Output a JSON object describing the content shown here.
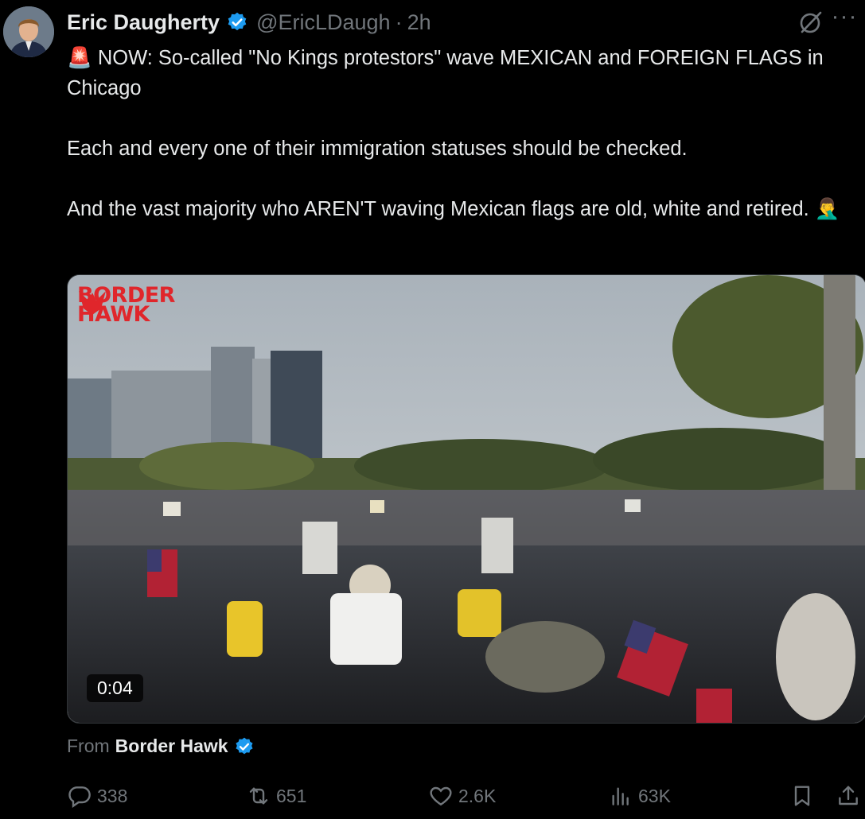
{
  "post": {
    "author_name": "Eric Daugherty",
    "handle": "@EricLDaugh",
    "separator": "·",
    "time": "2h",
    "more_label": "···",
    "text": "🚨 NOW: So-called \"No Kings protestors\" wave MEXICAN and FOREIGN FLAGS in Chicago\n\nEach and every one of their immigration statuses should be checked.\n\nAnd the vast majority who AREN'T waving Mexican flags are old, white and retired. 🤦‍♂️"
  },
  "media": {
    "logo_line1": "BORDER",
    "logo_line2": "HAWK",
    "duration": "0:04"
  },
  "source": {
    "label": "From",
    "name": "Border Hawk"
  },
  "actions": {
    "replies": "338",
    "reposts": "651",
    "likes": "2.6K",
    "views": "63K"
  },
  "colors": {
    "background": "#000000",
    "text": "#e7e9ea",
    "muted": "#71767b",
    "verified": "#1d9bf0",
    "logo_red": "#e0262b"
  },
  "icons": [
    "verified-badge-icon",
    "grok-icon",
    "more-icon",
    "reply-icon",
    "repost-icon",
    "like-icon",
    "views-icon",
    "bookmark-icon",
    "share-icon"
  ]
}
